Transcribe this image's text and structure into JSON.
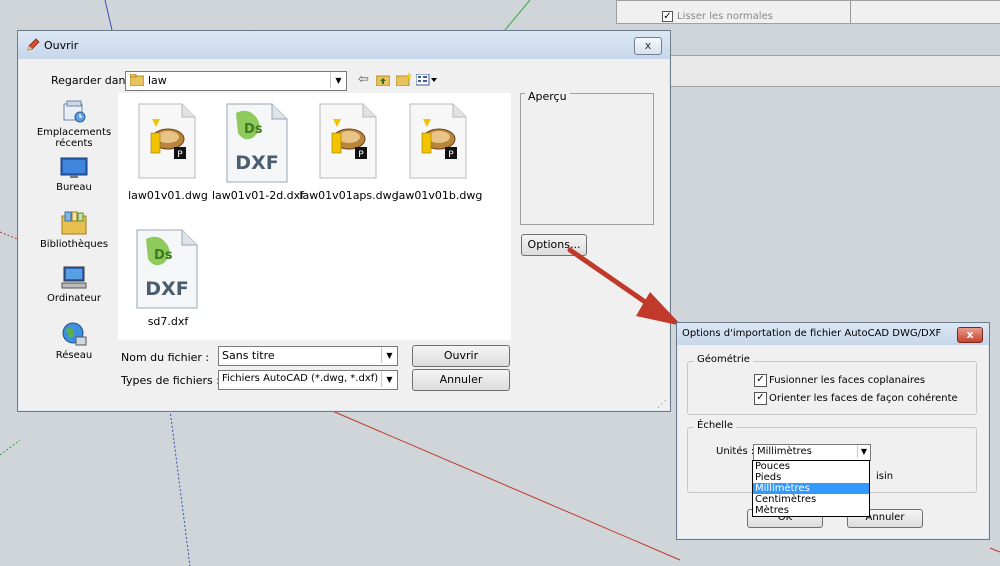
{
  "background": {
    "lisser_normales": "Lisser les normales"
  },
  "open_dialog": {
    "title": "Ouvrir",
    "close_label": "x",
    "look_in_label": "Regarder dans :",
    "look_in_value": "law",
    "preview_label": "Aperçu",
    "options_button": "Options...",
    "sidebar": [
      {
        "label": "Emplacements récents",
        "icon": "recent-places-icon"
      },
      {
        "label": "Bureau",
        "icon": "desktop-icon"
      },
      {
        "label": "Bibliothèques",
        "icon": "libraries-icon"
      },
      {
        "label": "Ordinateur",
        "icon": "computer-icon"
      },
      {
        "label": "Réseau",
        "icon": "network-icon"
      }
    ],
    "files": [
      {
        "name": "law01v01.dwg",
        "type": "dwg"
      },
      {
        "name": "law01v01-2d.dxf",
        "type": "dxf"
      },
      {
        "name": "law01v01aps.dwg",
        "type": "dwg"
      },
      {
        "name": "law01v01b.dwg",
        "type": "dwg"
      },
      {
        "name": "sd7.dxf",
        "type": "dxf"
      }
    ],
    "dxf_text": "DXF",
    "ds_text": "Ds",
    "filename_label": "Nom du fichier :",
    "filename_value": "Sans titre",
    "filetype_label": "Types de fichiers :",
    "filetype_value": "Fichiers AutoCAD (*.dwg, *.dxf)",
    "open_button": "Ouvrir",
    "cancel_button": "Annuler"
  },
  "options_dialog": {
    "title": "Options d'importation de fichier AutoCAD DWG/DXF",
    "close_label": "x",
    "geometry_group": "Géométrie",
    "merge_faces": "Fusionner les faces coplanaires",
    "orient_faces": "Orienter les faces de façon cohérente",
    "scale_group": "Échelle",
    "units_label": "Unités :",
    "units_value": "Millimètres",
    "units_options": [
      "Pouces",
      "Pieds",
      "Millimètres",
      "Centimètres",
      "Mètres"
    ],
    "units_selected_index": 2,
    "hidden_text_fragment": "isin",
    "ok_button": "OK",
    "cancel_button": "Annuler"
  },
  "colors": {
    "arrow": "#c0392b",
    "selection": "#3399ff",
    "close_red": "#c7452e"
  }
}
